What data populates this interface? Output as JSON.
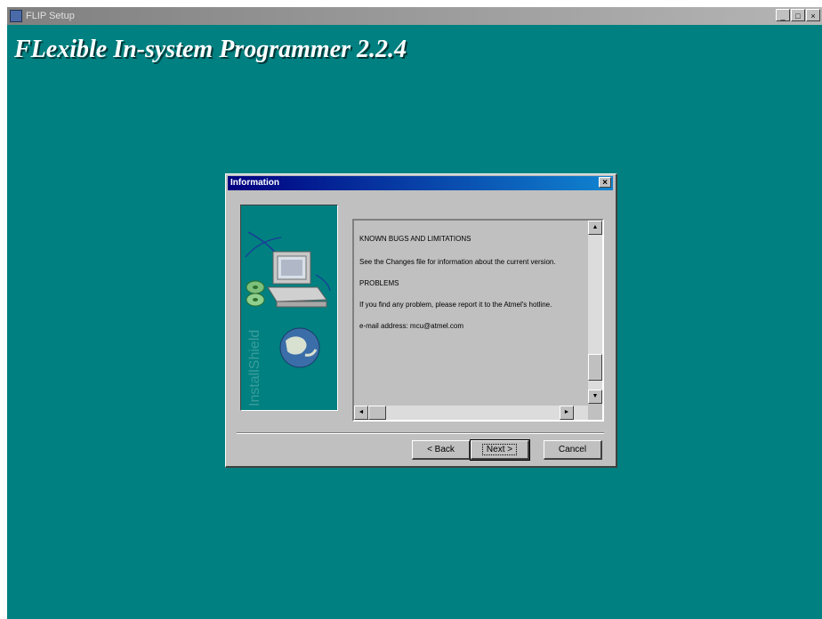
{
  "outer_window": {
    "title": "FLIP Setup",
    "controls": [
      "_",
      "□",
      "×"
    ]
  },
  "banner": {
    "title": "FLexible In-system Programmer 2.2.4"
  },
  "dialog": {
    "title": "Information",
    "close_label": "×",
    "side_image_caption": "InstallShield",
    "text_lines": [
      "KNOWN BUGS AND LIMITATIONS",
      "See the Changes file for information about  the current version.",
      "PROBLEMS",
      "If you find any problem, please report it to the Atmel's hotline.",
      "e-mail address: mcu@atmel.com"
    ],
    "scroll": {
      "up": "▲",
      "down": "▼",
      "left": "◄",
      "right": "►"
    },
    "buttons": {
      "back": "< Back",
      "next": "Next >",
      "cancel": "Cancel"
    }
  }
}
